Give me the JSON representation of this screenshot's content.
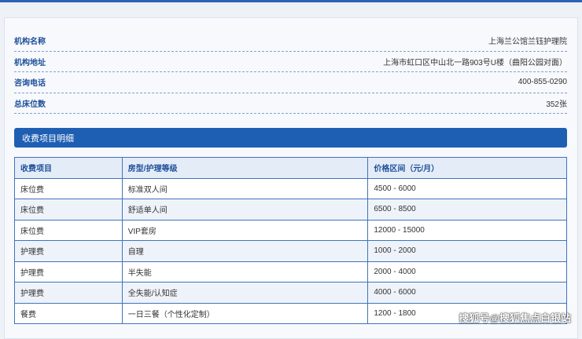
{
  "info": [
    {
      "label": "机构名称",
      "value": "上海兰公馆兰钰护理院"
    },
    {
      "label": "机构地址",
      "value": "上海市虹口区中山北一路903号U楼（曲阳公园对面）"
    },
    {
      "label": "咨询电话",
      "value": "400-855-0290"
    },
    {
      "label": "总床位数",
      "value": "352张"
    }
  ],
  "fees": {
    "title": "收费项目明细",
    "columns": [
      "收费项目",
      "房型/护理等级",
      "价格区间（元/月）"
    ],
    "rows": [
      [
        "床位费",
        "标准双人间",
        "4500 - 6000"
      ],
      [
        "床位费",
        "舒适单人间",
        "6500 - 8500"
      ],
      [
        "床位费",
        "VIP套房",
        "12000 - 15000"
      ],
      [
        "护理费",
        "自理",
        "1000 - 2000"
      ],
      [
        "护理费",
        "半失能",
        "2000 - 4000"
      ],
      [
        "护理费",
        "全失能/认知症",
        "4000 - 6000"
      ],
      [
        "餐费",
        "一日三餐（个性化定制）",
        "1200 - 1800"
      ]
    ]
  },
  "watermark": "搜狐号@搜狐焦点白银站",
  "colors": {
    "accent": "#1e5fb3",
    "label": "#1e4f9a",
    "border": "#3f74bd"
  }
}
